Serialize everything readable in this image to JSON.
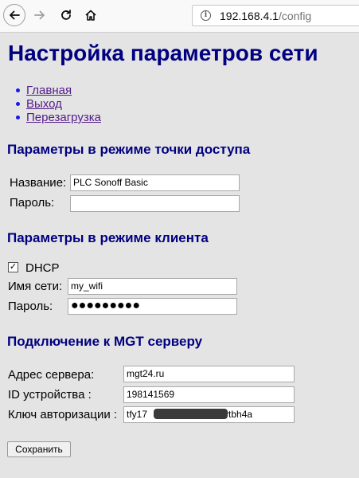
{
  "browser": {
    "url_host": "192.168.4.1",
    "url_path": "/config",
    "icons": [
      "back-arrow-icon",
      "forward-arrow-icon",
      "reload-icon",
      "home-icon",
      "site-info-icon"
    ]
  },
  "page": {
    "title": "Настройка параметров сети",
    "links": [
      "Главная",
      "Выход",
      "Перезагрузка"
    ],
    "ap_section": {
      "heading": "Параметры в режиме точки доступа",
      "name_label": "Название:",
      "name_value": "PLC Sonoff Basic",
      "password_label": "Пароль:",
      "password_value": ""
    },
    "client_section": {
      "heading": "Параметры в режиме клиента",
      "dhcp_label": "DHCP",
      "dhcp_checked": true,
      "ssid_label": "Имя сети:",
      "ssid_value": "my_wifi",
      "password_label": "Пароль:",
      "password_mask": "●●●●●●●●●"
    },
    "mgt_section": {
      "heading": "Подключение к MGT серверу",
      "server_label": "Адрес сервера:",
      "server_value": "mgt24.ru",
      "device_label": "ID устройства :",
      "device_value": "198141569",
      "key_label": "Ключ авторизации :",
      "key_value_start": "tfy17",
      "key_value_end": "vtbh4a"
    },
    "save_label": "Сохранить"
  }
}
